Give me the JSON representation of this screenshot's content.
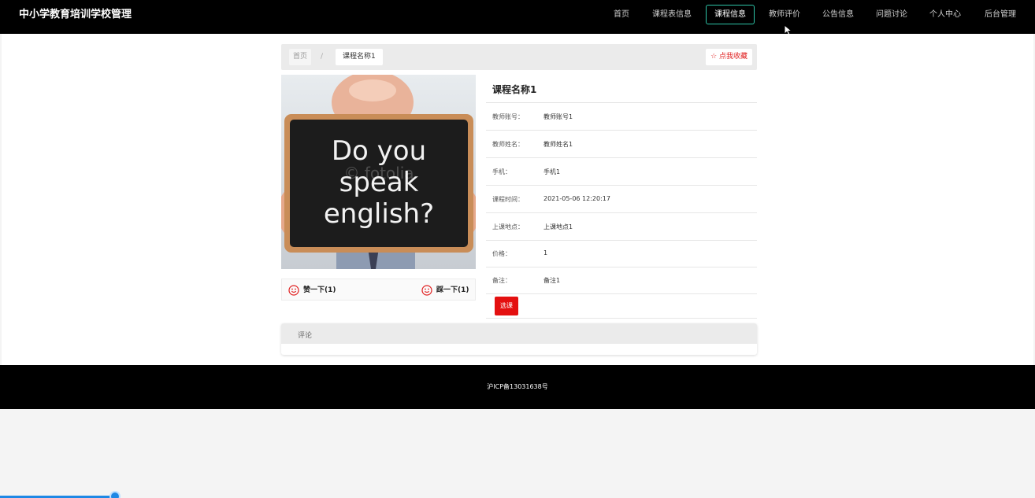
{
  "header": {
    "brand": "中小学教育培训学校管理",
    "nav": [
      {
        "label": "首页"
      },
      {
        "label": "课程表信息"
      },
      {
        "label": "课程信息",
        "active": true
      },
      {
        "label": "教师评价"
      },
      {
        "label": "公告信息"
      },
      {
        "label": "问题讨论"
      },
      {
        "label": "个人中心"
      },
      {
        "label": "后台管理"
      }
    ],
    "active_border_color": "#2ec4a7"
  },
  "breadcrumb": {
    "home": "首页",
    "separator": "/",
    "current": "课程名称1",
    "favorite_label": "☆ 点我收藏"
  },
  "course": {
    "image_text": [
      "Do you",
      "speak",
      "english?"
    ],
    "image_watermark": "© fotolia",
    "title": "课程名称1",
    "fields": [
      {
        "key": "教师账号：",
        "value": "教师账号1"
      },
      {
        "key": "教师姓名：",
        "value": "教师姓名1"
      },
      {
        "key": "手机：",
        "value": "手机1"
      },
      {
        "key": "课程时间：",
        "value": "2021-05-06 12:20:17"
      },
      {
        "key": "上课地点：",
        "value": "上课地点1"
      },
      {
        "key": "价格：",
        "value": "1"
      },
      {
        "key": "备注：",
        "value": "备注1"
      }
    ],
    "select_label": "选课"
  },
  "votes": {
    "like_label": "赞一下(1)",
    "dislike_label": "踩一下(1)",
    "icon_color": "#e02020"
  },
  "comments": {
    "title": "评论"
  },
  "footer": {
    "icp": "沪ICP备13031638号"
  },
  "progress": {
    "fraction": 0.111,
    "color": "#1e88e5"
  }
}
